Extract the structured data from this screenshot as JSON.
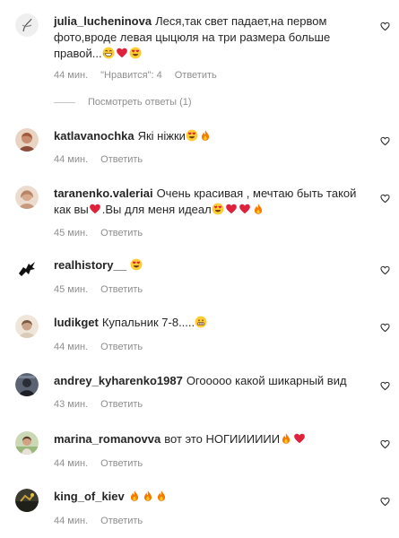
{
  "like_button_label": "♡",
  "replies_toggle": "Посмотреть ответы (1)",
  "comments": [
    {
      "username": "julia_lucheninova",
      "text": "Леся,так свет падает,на первом фото,вроде левая цыцюля на три размера больше правой...",
      "emojis": [
        "grin-icon",
        "heart-icon",
        "heart-eyes-icon"
      ],
      "time": "44 мин.",
      "likes": "\"Нравится\": 4",
      "reply": "Ответить",
      "avatar_color": "#e8e8e8"
    },
    {
      "username": "katlavanochka",
      "text": "Які ніжки",
      "emojis": [
        "heart-eyes-icon",
        "fire-icon"
      ],
      "time": "44 мин.",
      "reply": "Ответить",
      "avatar_color": "#c98b72"
    },
    {
      "username": "taranenko.valeriai",
      "text": "Очень красивая , мечтаю быть такой как вы",
      "emojis": [
        "heart-icon"
      ],
      "text2": ".Вы для меня идеал",
      "emojis2": [
        "heart-eyes-icon",
        "heart-icon",
        "heart-icon",
        "fire-icon"
      ],
      "time": "45 мин.",
      "reply": "Ответить",
      "avatar_color": "#d7b8a0"
    },
    {
      "username": "realhistory__",
      "text": "",
      "emojis": [
        "heart-eyes-icon"
      ],
      "time": "45 мин.",
      "reply": "Ответить",
      "avatar_color": "#ffffff"
    },
    {
      "username": "ludikget",
      "text": "Купальник 7-8.....",
      "emojis": [
        "grimace-icon"
      ],
      "time": "44 мин.",
      "reply": "Ответить",
      "avatar_color": "#e4dccf"
    },
    {
      "username": "andrey_kyharenko1987",
      "text": "Огооооо какой шикарный вид",
      "emojis": [],
      "time": "43 мин.",
      "reply": "Ответить",
      "avatar_color": "#4a5160"
    },
    {
      "username": "marina_romanovva",
      "text": "вот это НОГИИИИИИ",
      "emojis": [
        "fire-icon",
        "heart-icon"
      ],
      "time": "44 мин.",
      "reply": "Ответить",
      "avatar_color": "#b9c7a3"
    },
    {
      "username": "king_of_kiev",
      "text": "",
      "emojis": [
        "fire-icon",
        "fire-icon",
        "fire-icon"
      ],
      "time": "44 мин.",
      "reply": "Ответить",
      "avatar_color": "#3b3a2e"
    }
  ]
}
